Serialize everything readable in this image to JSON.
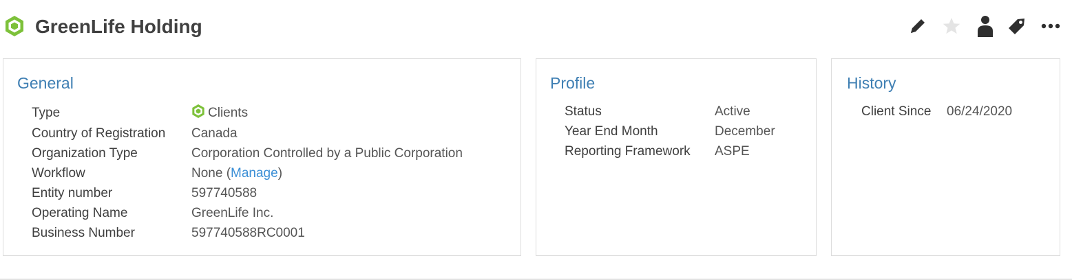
{
  "header": {
    "title": "GreenLife Holding",
    "icon": "green-hexagon-icon",
    "accent_color": "#7dc13a",
    "toolbar": [
      {
        "name": "edit-pencil-icon"
      },
      {
        "name": "favorite-star-icon"
      },
      {
        "name": "user-assign-icon"
      },
      {
        "name": "tag-icon"
      },
      {
        "name": "more-options-icon"
      }
    ]
  },
  "general": {
    "title": "General",
    "rows": {
      "type": {
        "label": "Type",
        "value": "Clients"
      },
      "country": {
        "label": "Country of Registration",
        "value": "Canada"
      },
      "org_type": {
        "label": "Organization Type",
        "value": "Corporation Controlled by a Public Corporation"
      },
      "workflow": {
        "label": "Workflow",
        "value_prefix": "None (",
        "link": "Manage",
        "value_suffix": ")"
      },
      "entity_number": {
        "label": "Entity number",
        "value": "597740588"
      },
      "operating_name": {
        "label": "Operating Name",
        "value": "GreenLife Inc."
      },
      "business_number": {
        "label": "Business Number",
        "value": "597740588RC0001"
      }
    }
  },
  "profile": {
    "title": "Profile",
    "rows": {
      "status": {
        "label": "Status",
        "value": "Active"
      },
      "year_end": {
        "label": "Year End Month",
        "value": "December"
      },
      "framework": {
        "label": "Reporting Framework",
        "value": "ASPE"
      }
    }
  },
  "history": {
    "title": "History",
    "rows": {
      "client_since": {
        "label": "Client Since",
        "value": "06/24/2020"
      }
    }
  }
}
